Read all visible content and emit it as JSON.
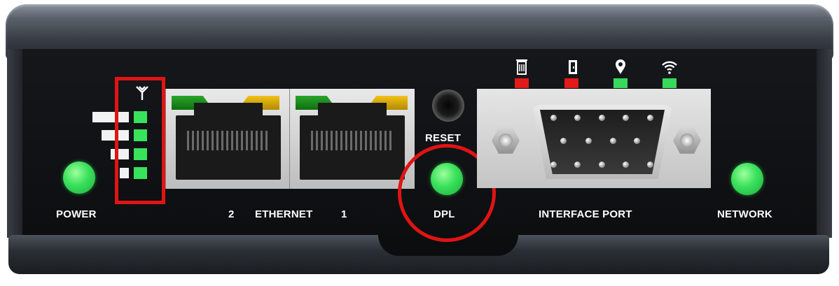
{
  "labels": {
    "power": "POWER",
    "ethernet_port_2": "2",
    "ethernet": "ETHERNET",
    "ethernet_port_1": "1",
    "reset": "RESET",
    "dpl": "DPL",
    "interface_port": "INTERFACE PORT",
    "network": "NETWORK"
  },
  "signal_strength": {
    "bars_total": 4,
    "bars_lit": 4
  },
  "status_indicators": [
    {
      "icon": "sd-card-icon",
      "color": "#e21a1a"
    },
    {
      "icon": "door-icon",
      "color": "#e21a1a"
    },
    {
      "icon": "location-pin-icon",
      "color": "#36d95a"
    },
    {
      "icon": "wifi-icon",
      "color": "#36d95a"
    }
  ],
  "led_colors": {
    "power": "#39e05b",
    "dpl": "#39e05b",
    "network": "#39e05b",
    "ethernet_link": "#1f8f1f",
    "ethernet_activity": "#e0b00f"
  },
  "highlight_colors": {
    "annotation": "#e01414"
  }
}
